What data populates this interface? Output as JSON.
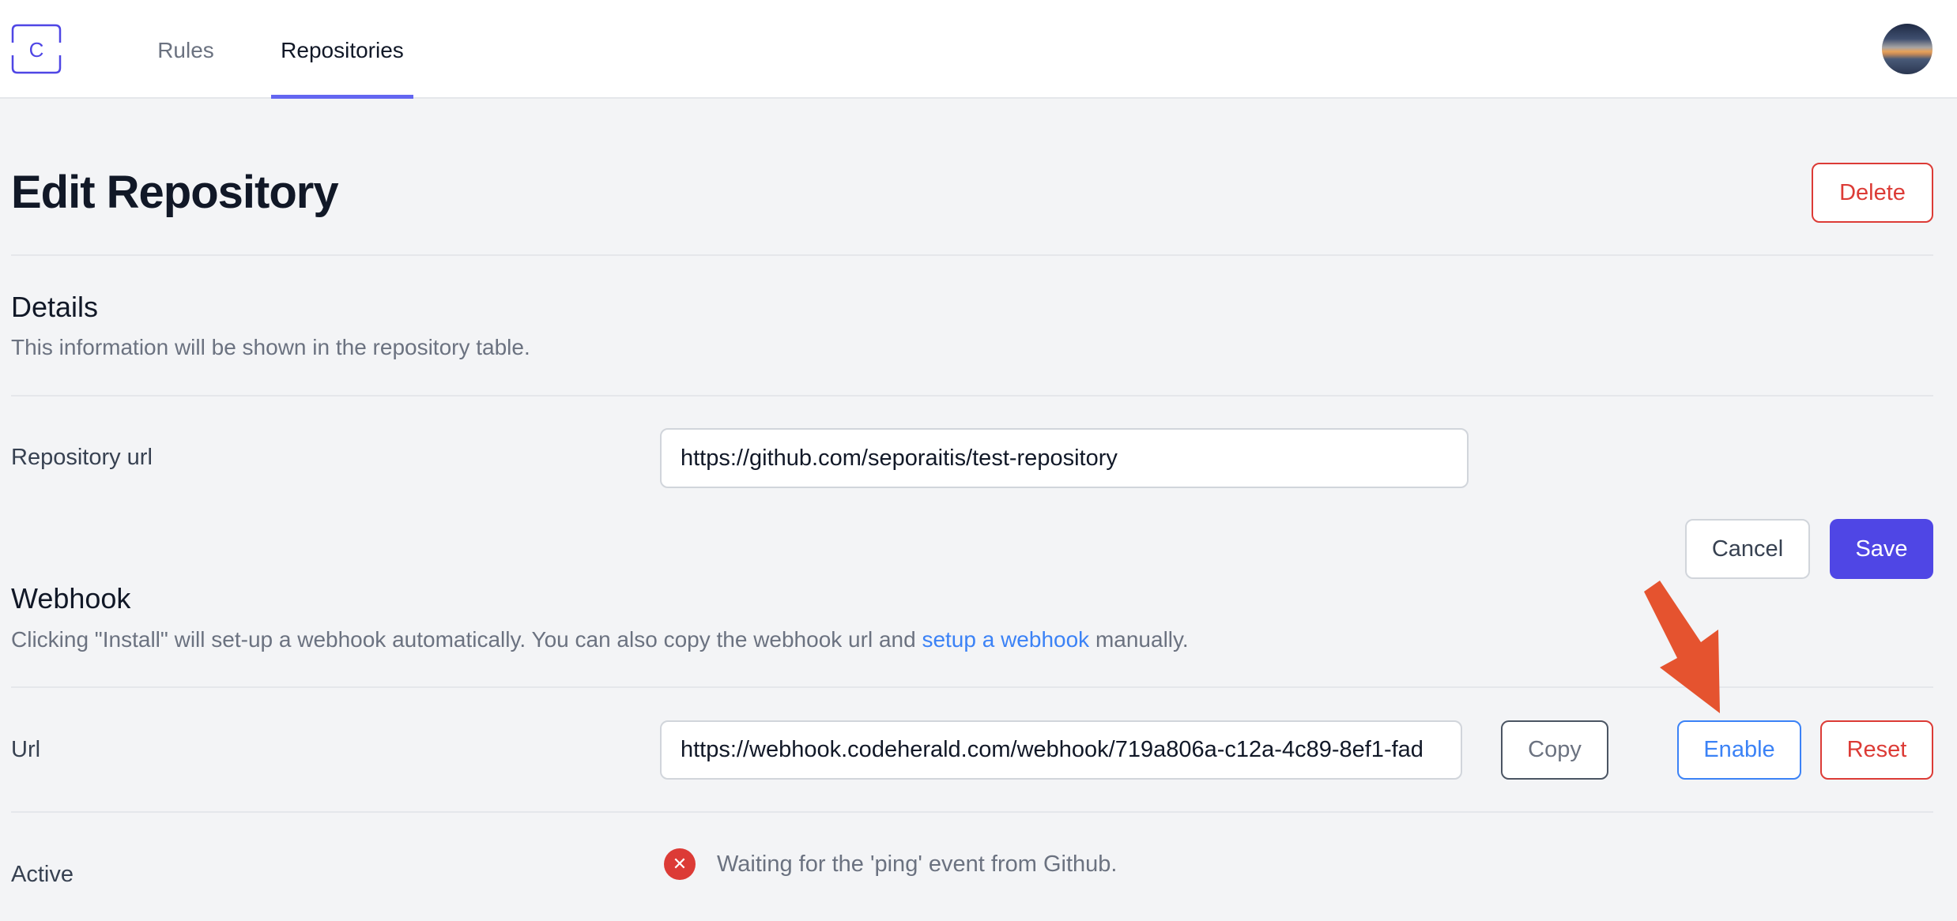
{
  "nav": {
    "logo_letter": "C",
    "tabs": [
      {
        "label": "Rules",
        "active": false
      },
      {
        "label": "Repositories",
        "active": true
      }
    ]
  },
  "page": {
    "title": "Edit Repository",
    "delete_label": "Delete"
  },
  "details": {
    "title": "Details",
    "description": "This information will be shown in the repository table.",
    "repo_url_label": "Repository url",
    "repo_url_value": "https://github.com/seporaitis/test-repository",
    "cancel_label": "Cancel",
    "save_label": "Save"
  },
  "webhook": {
    "title": "Webhook",
    "description_before": "Clicking \"Install\" will set-up a webhook automatically. You can also copy the webhook url and ",
    "description_link": "setup a webhook",
    "description_after": " manually.",
    "url_label": "Url",
    "url_value": "https://webhook.codeherald.com/webhook/719a806a-c12a-4c89-8ef1-fad",
    "copy_label": "Copy",
    "enable_label": "Enable",
    "reset_label": "Reset",
    "active_label": "Active",
    "status_icon": "close-circle-icon",
    "status_text": "Waiting for the 'ping' event from Github."
  },
  "colors": {
    "accent": "#4f46e5",
    "tab_underline": "#6366f1",
    "danger": "#dc3b36",
    "link": "#3b82f6",
    "annotation_arrow": "#e5532f"
  }
}
